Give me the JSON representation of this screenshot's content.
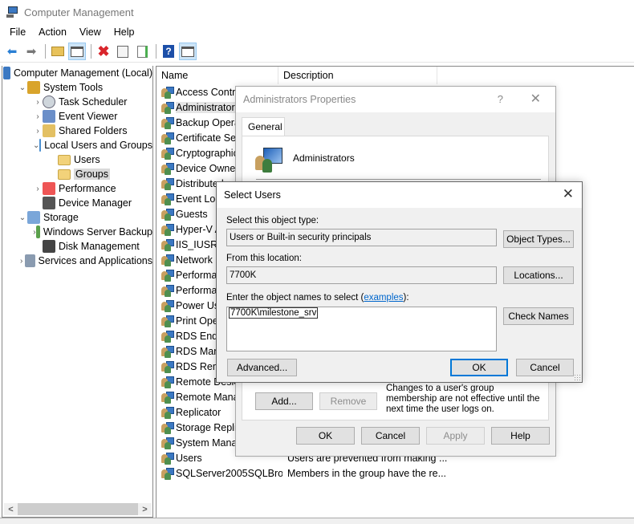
{
  "window": {
    "title": "Computer Management"
  },
  "menu": [
    "File",
    "Action",
    "View",
    "Help"
  ],
  "toolbar": {
    "buttons": [
      {
        "icon": "back-arrow-icon"
      },
      {
        "icon": "forward-arrow-icon"
      },
      {
        "icon": "up-folder-icon"
      },
      {
        "icon": "show-hide-console-tree-icon",
        "active": true
      },
      {
        "icon": "delete-icon"
      },
      {
        "icon": "properties-icon"
      },
      {
        "icon": "export-list-icon"
      },
      {
        "icon": "help-icon"
      },
      {
        "icon": "show-hide-action-pane-icon",
        "active": true
      }
    ]
  },
  "tree": [
    {
      "label": "Computer Management (Local)",
      "level": 0,
      "expander": "",
      "icon": "computer-icon"
    },
    {
      "label": "System Tools",
      "level": 1,
      "expander": "⌄",
      "icon": "tools-icon"
    },
    {
      "label": "Task Scheduler",
      "level": 2,
      "expander": "›",
      "icon": "clock-icon"
    },
    {
      "label": "Event Viewer",
      "level": 2,
      "expander": "›",
      "icon": "event-viewer-icon"
    },
    {
      "label": "Shared Folders",
      "level": 2,
      "expander": "›",
      "icon": "shared-folder-icon"
    },
    {
      "label": "Local Users and Groups",
      "level": 2,
      "expander": "⌄",
      "icon": "users-groups-icon"
    },
    {
      "label": "Users",
      "level": 3,
      "expander": "",
      "icon": "folder-icon"
    },
    {
      "label": "Groups",
      "level": 3,
      "expander": "",
      "icon": "folder-icon",
      "selected": true
    },
    {
      "label": "Performance",
      "level": 2,
      "expander": "›",
      "icon": "performance-icon"
    },
    {
      "label": "Device Manager",
      "level": 2,
      "expander": "",
      "icon": "device-manager-icon"
    },
    {
      "label": "Storage",
      "level": 1,
      "expander": "⌄",
      "icon": "storage-icon"
    },
    {
      "label": "Windows Server Backup",
      "level": 2,
      "expander": "›",
      "icon": "backup-icon"
    },
    {
      "label": "Disk Management",
      "level": 2,
      "expander": "",
      "icon": "disk-icon"
    },
    {
      "label": "Services and Applications",
      "level": 1,
      "expander": "›",
      "icon": "services-icon"
    }
  ],
  "list": {
    "columns": [
      "Name",
      "Description"
    ],
    "rows": [
      {
        "name": "Access Control...",
        "desc": ""
      },
      {
        "name": "Administrators",
        "desc": "",
        "selected": true
      },
      {
        "name": "Backup Operators",
        "desc": ""
      },
      {
        "name": "Certificate Serv...",
        "desc": ""
      },
      {
        "name": "Cryptographic...",
        "desc": ""
      },
      {
        "name": "Device Owners",
        "desc": ""
      },
      {
        "name": "Distributed...",
        "desc": ""
      },
      {
        "name": "Event Log...",
        "desc": ""
      },
      {
        "name": "Guests",
        "desc": ""
      },
      {
        "name": "Hyper-V A...",
        "desc": ""
      },
      {
        "name": "IIS_IUSRS",
        "desc": ""
      },
      {
        "name": "Network C...",
        "desc": ""
      },
      {
        "name": "Performance...",
        "desc": ""
      },
      {
        "name": "Performance...",
        "desc": ""
      },
      {
        "name": "Power Users",
        "desc": ""
      },
      {
        "name": "Print Operators",
        "desc": ""
      },
      {
        "name": "RDS Endpoint...",
        "desc": ""
      },
      {
        "name": "RDS Management...",
        "desc": ""
      },
      {
        "name": "RDS Remote...",
        "desc": ""
      },
      {
        "name": "Remote Desktop...",
        "desc": ""
      },
      {
        "name": "Remote Management...",
        "desc": ""
      },
      {
        "name": "Replicator",
        "desc": ""
      },
      {
        "name": "Storage Replica...",
        "desc": ""
      },
      {
        "name": "System Managed...",
        "desc": ""
      },
      {
        "name": "Users",
        "desc": "Users are prevented from making ..."
      },
      {
        "name": "SQLServer2005SQLBro...",
        "desc": "Members in the group have the re..."
      }
    ]
  },
  "props_dialog": {
    "title": "Administrators Properties",
    "help_glyph": "?",
    "close_glyph": "✕",
    "tab": "General",
    "group_name": "Administrators",
    "add_label": "Add...",
    "remove_label": "Remove",
    "note": "Changes to a user's group membership are not effective until the next time the user logs on.",
    "ok_label": "OK",
    "cancel_label": "Cancel",
    "apply_label": "Apply",
    "help_label": "Help"
  },
  "select_dialog": {
    "title": "Select Users",
    "close_glyph": "✕",
    "object_type_label": "Select this object type:",
    "object_type_value": "Users or Built-in security principals",
    "object_types_button": "Object Types...",
    "location_label": "From this location:",
    "location_value": "7700K",
    "locations_button": "Locations...",
    "names_label_prefix": "Enter the object names to select (",
    "names_label_link": "examples",
    "names_label_suffix": "):",
    "names_value": "7700K\\milestone_srv",
    "check_names_button": "Check Names",
    "advanced_button": "Advanced...",
    "ok_button": "OK",
    "cancel_button": "Cancel"
  }
}
